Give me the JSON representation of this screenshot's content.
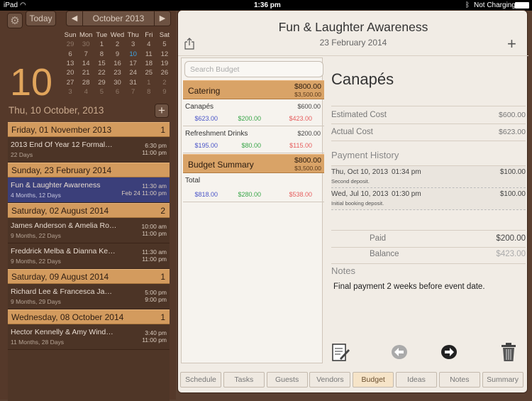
{
  "status": {
    "carrier": "iPad",
    "time": "1:36 pm",
    "battery": "Not Charging"
  },
  "calendar": {
    "today_label": "Today",
    "month_label": "October 2013",
    "prev_arrow": "◀",
    "next_arrow": "▶",
    "weekdays": [
      "Sun",
      "Mon",
      "Tue",
      "Wed",
      "Thu",
      "Fri",
      "Sat"
    ],
    "weeks": [
      [
        "29",
        "30",
        "1",
        "2",
        "3",
        "4",
        "5"
      ],
      [
        "6",
        "7",
        "8",
        "9",
        "10",
        "11",
        "12"
      ],
      [
        "13",
        "14",
        "15",
        "16",
        "17",
        "18",
        "19"
      ],
      [
        "20",
        "21",
        "22",
        "23",
        "24",
        "25",
        "26"
      ],
      [
        "27",
        "28",
        "29",
        "30",
        "31",
        "1",
        "2"
      ],
      [
        "3",
        "4",
        "5",
        "6",
        "7",
        "8",
        "9"
      ]
    ],
    "big_day": "10",
    "selected_date": "Thu, 10 October, 2013"
  },
  "events": {
    "groups": [
      {
        "header": "Friday, 01 November 2013",
        "count": "1",
        "items": [
          {
            "title": "2013 End Of Year 12 Formal…",
            "sub": "22 Days",
            "time1": "6:30 pm",
            "time2": "11:00 pm"
          }
        ]
      },
      {
        "header": "Sunday, 23 February 2014",
        "count": "",
        "items": [
          {
            "title": "Fun & Laughter Awareness",
            "sub": "4 Months, 12 Days",
            "time1": "11:30 am",
            "time2": "Feb 24  11:00 pm",
            "selected": true
          }
        ]
      },
      {
        "header": "Saturday, 02 August 2014",
        "count": "2",
        "items": [
          {
            "title": "James Anderson & Amelia Ro…",
            "sub": "9 Months, 22 Days",
            "time1": "10:00 am",
            "time2": "11:00 pm"
          },
          {
            "title": "Freddrick Melba & Dianna Ke…",
            "sub": "9 Months, 22 Days",
            "time1": "11:30 am",
            "time2": "11:00 pm"
          }
        ]
      },
      {
        "header": "Saturday, 09 August 2014",
        "count": "1",
        "items": [
          {
            "title": "Richard Lee & Francesca Ja…",
            "sub": "9 Months, 29 Days",
            "time1": "5:00 pm",
            "time2": "9:00 pm"
          }
        ]
      },
      {
        "header": "Wednesday, 08 October 2014",
        "count": "1",
        "items": [
          {
            "title": "Hector Kennelly & Amy Wind…",
            "sub": "11 Months, 28 Days",
            "time1": "3:40 pm",
            "time2": "11:00 pm"
          }
        ]
      }
    ]
  },
  "event": {
    "title": "Fun & Laughter Awareness",
    "date": "23 February 2014"
  },
  "budget": {
    "search_placeholder": "Search Budget",
    "group1": {
      "name": "Catering",
      "amount": "$800.00",
      "sub": "$3,500.00"
    },
    "lines": [
      {
        "name": "Canapés",
        "planned": "$600.00",
        "v1": "$623.00",
        "v2": "$200.00",
        "v3": "$423.00"
      },
      {
        "name": "Refreshment Drinks",
        "planned": "$200.00",
        "v1": "$195.00",
        "v2": "$80.00",
        "v3": "$115.00"
      }
    ],
    "group2": {
      "name": "Budget Summary",
      "amount": "$800.00",
      "sub": "$3,500.00"
    },
    "total": {
      "name": "Total",
      "v1": "$818.00",
      "v2": "$280.00",
      "v3": "$538.00"
    }
  },
  "detail": {
    "name": "Canapés",
    "estimated_label": "Estimated Cost",
    "estimated": "$600.00",
    "actual_label": "Actual Cost",
    "actual": "$623.00",
    "history_label": "Payment History",
    "payments": [
      {
        "date": "Thu, Oct 10, 2013",
        "time": "01:34 pm",
        "amount": "$100.00",
        "note": "Second deposit."
      },
      {
        "date": "Wed, Jul 10, 2013",
        "time": "01:30 pm",
        "amount": "$100.00",
        "note": "Initial booking deposit."
      }
    ],
    "paid_label": "Paid",
    "paid": "$200.00",
    "balance_label": "Balance",
    "balance": "$423.00",
    "notes_label": "Notes",
    "notes": "Final payment 2 weeks before event date."
  },
  "tabs": [
    "Schedule",
    "Tasks",
    "Guests",
    "Vendors",
    "Budget",
    "Ideas",
    "Notes",
    "Summary"
  ],
  "active_tab": "Budget",
  "colors": {
    "accent_orange": "#d9a367",
    "selected_event": "#3b3f7a",
    "today_blue": "#3ea6e6"
  }
}
